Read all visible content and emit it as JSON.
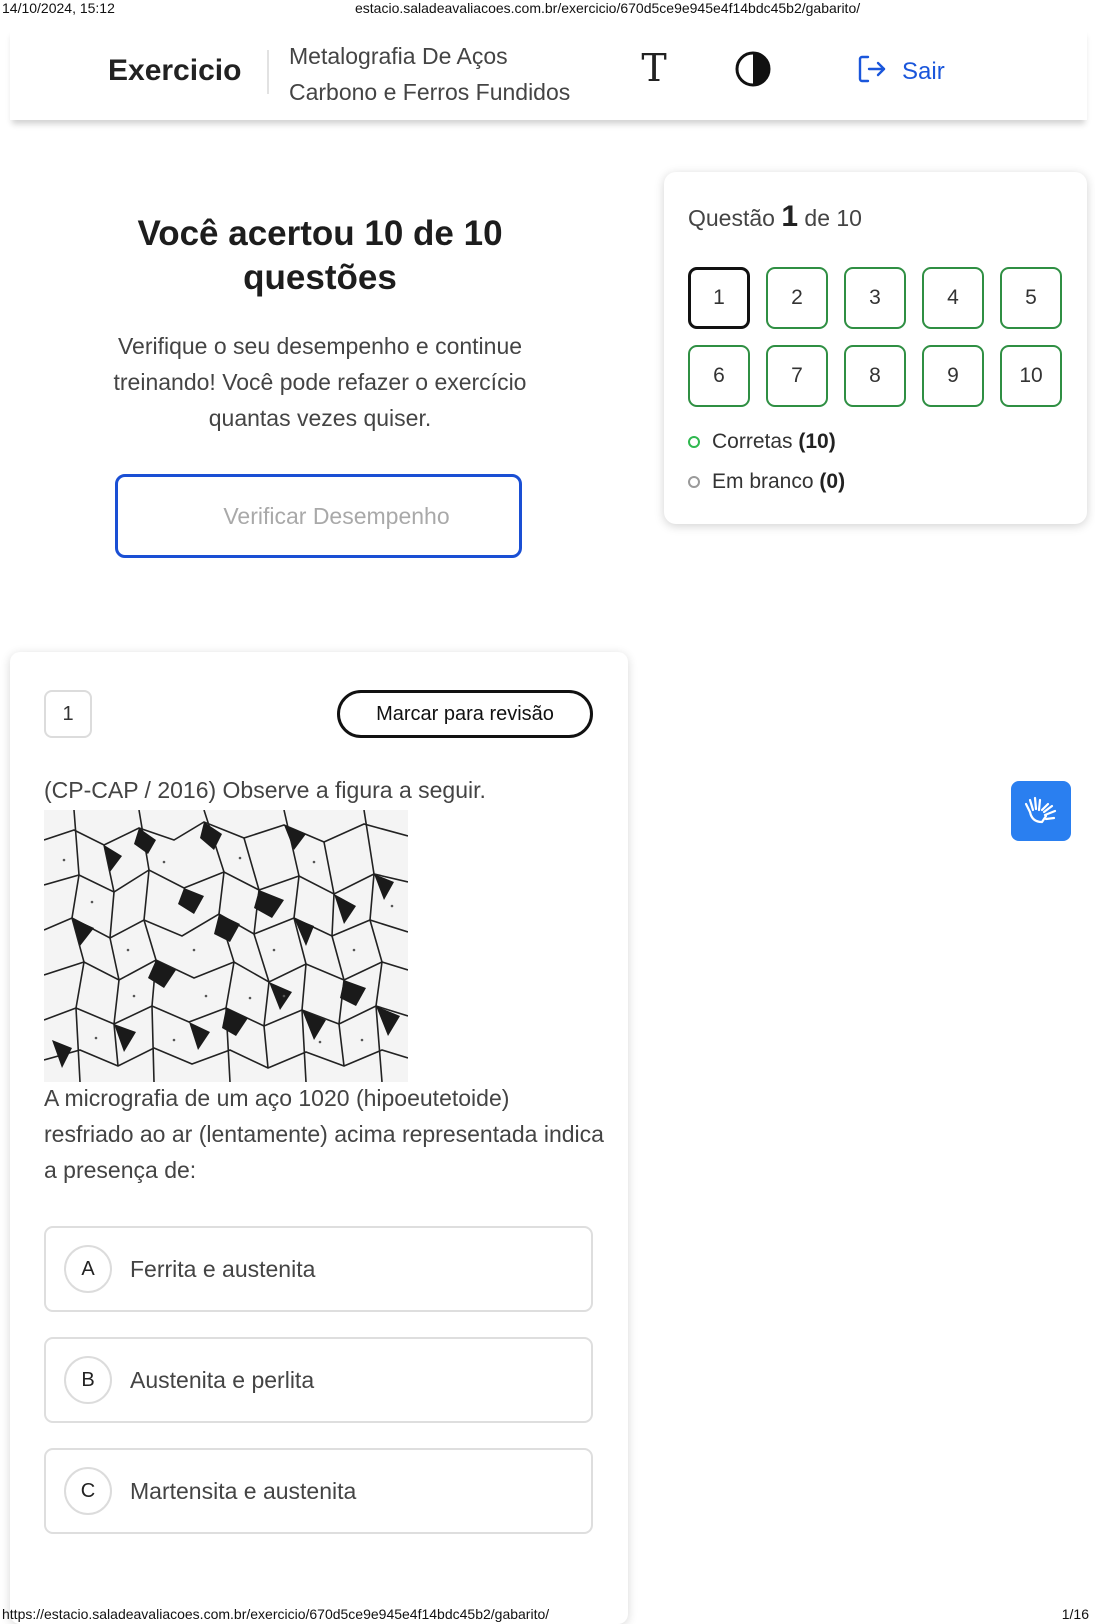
{
  "print": {
    "date": "14/10/2024, 15:12",
    "top_url": "estacio.saladeavaliacoes.com.br/exercicio/670d5ce9e945e4f14bdc45b2/gabarito/",
    "bottom_url": "https://estacio.saladeavaliacoes.com.br/exercicio/670d5ce9e945e4f14bdc45b2/gabarito/",
    "page": "1/16"
  },
  "header": {
    "brand": "Exercicio",
    "course_line1": "Metalografia De Aços",
    "course_line2": "Carbono e Ferros Fundidos",
    "font_icon_glyph": "T",
    "logout_label": "Sair",
    "accent": "#1a56db"
  },
  "result": {
    "title": "Você acertou 10 de 10 questões",
    "message": "Verifique o seu desempenho e continue treinando! Você pode refazer o exercício quantas vezes quiser.",
    "verify_label": "Verificar Desempenho"
  },
  "navigator": {
    "title_prefix": "Questão",
    "current": "1",
    "title_suffix": "de 10",
    "items": [
      "1",
      "2",
      "3",
      "4",
      "5",
      "6",
      "7",
      "8",
      "9",
      "10"
    ],
    "correct_label": "Corretas",
    "correct_count": "(10)",
    "blank_label": "Em branco",
    "blank_count": "(0)",
    "correct_color": "#2f8f43"
  },
  "question": {
    "number": "1",
    "review_label": "Marcar para revisão",
    "intro": "(CP-CAP / 2016) Observe a figura a seguir.",
    "text": "A micrografia de um aço 1020 (hipoeutetoide) resfriado ao ar (lentamente) acima representada indica a presença de:",
    "options": [
      {
        "letter": "A",
        "text": "Ferrita e austenita"
      },
      {
        "letter": "B",
        "text": "Austenita e perlita"
      },
      {
        "letter": "C",
        "text": "Martensita e austenita"
      }
    ]
  },
  "accessibility": {
    "libras_icon": "hands-sign-language-icon",
    "libras_color": "#2a7ff0"
  }
}
